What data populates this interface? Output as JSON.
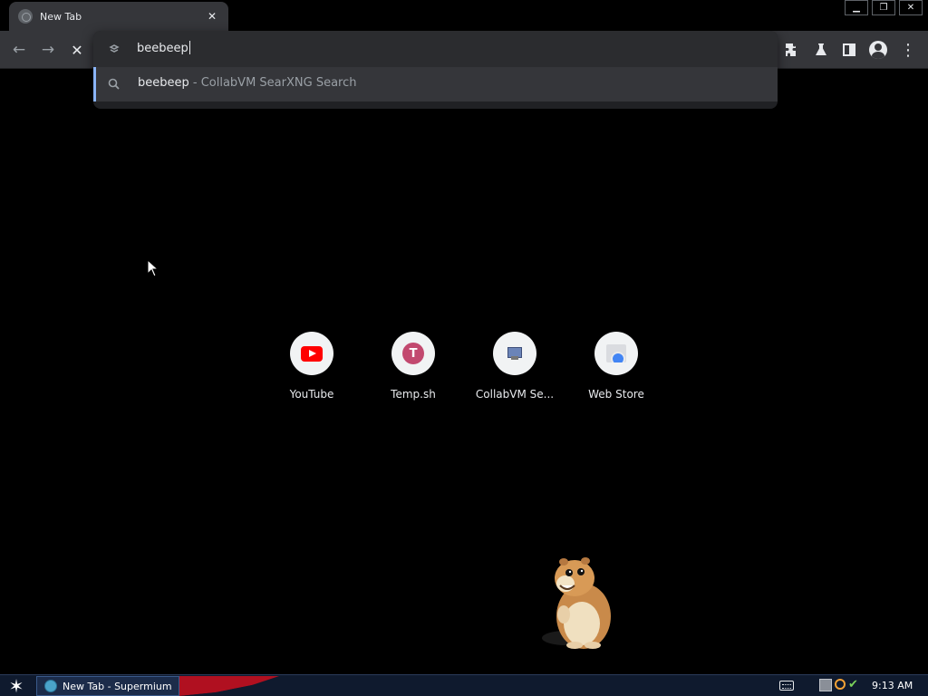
{
  "browser": {
    "tab": {
      "title": "New Tab",
      "close_glyph": "✕",
      "favicon": "globe-icon"
    },
    "window_controls": {
      "minimize": "▁",
      "restore": "❐",
      "close": "✕"
    },
    "nav": {
      "back": "←",
      "forward": "→",
      "stop": "✕"
    },
    "toolbar_icons": [
      "extensions-icon",
      "labs-flask-icon",
      "side-panel-icon",
      "profile-icon",
      "menu-icon"
    ]
  },
  "omnibox": {
    "input_value": "beebeep",
    "suggestions": [
      {
        "query": "beebeep",
        "description": " - CollabVM SearXNG Search",
        "icon": "search-icon"
      }
    ]
  },
  "shortcuts": [
    {
      "label": "YouTube",
      "icon": "youtube-icon"
    },
    {
      "label": "Temp.sh",
      "icon": "temp-sh-icon",
      "letter": "T"
    },
    {
      "label": "CollabVM Se...",
      "icon": "collabvm-icon"
    },
    {
      "label": "Web Store",
      "icon": "web-store-icon"
    }
  ],
  "taskbar": {
    "start_glyph": "✶",
    "items": [
      {
        "label": "New Tab - Supermium",
        "icon": "supermium-icon"
      }
    ],
    "tray_icons": [
      "keyboard-icon",
      "network-icon",
      "search-tray-icon",
      "update-tray-icon"
    ],
    "clock": "9:13 AM"
  },
  "colors": {
    "page_background": "#000000",
    "toolbar": "#35363a",
    "omnibox_accent": "#8ab4f8",
    "taskbar": "#0f1a2e"
  }
}
